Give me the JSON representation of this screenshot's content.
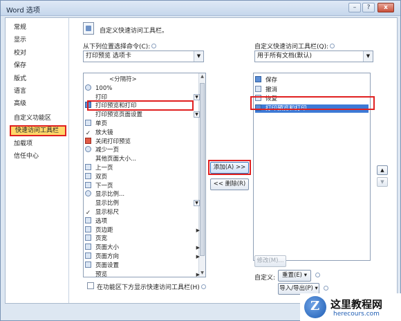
{
  "window": {
    "title": "Word 选项",
    "minimize": "–",
    "maximize": "?",
    "close": "x"
  },
  "nav": {
    "items": [
      "常规",
      "显示",
      "校对",
      "保存",
      "版式",
      "语言",
      "高级",
      "自定义功能区",
      "快速访问工具栏",
      "加载项",
      "信任中心"
    ],
    "active_index": 8
  },
  "main": {
    "heading": "自定义快速访问工具栏。",
    "choose_label": "从下列位置选择命令(C):",
    "choose_value": "打印预览 选项卡",
    "customize_label": "自定义快速访问工具栏(Q):",
    "customize_value": "用于所有文档(默认)",
    "commands": [
      {
        "label": "<分隔符>",
        "icon": "none"
      },
      {
        "label": "100%",
        "icon": "zoom-icon"
      },
      {
        "label": "打印",
        "icon": "none",
        "mark": "dropdown"
      },
      {
        "label": "打印预览和打印",
        "icon": "print-preview-icon"
      },
      {
        "label": "打印预览页面设置",
        "icon": "none",
        "mark": "dropdown"
      },
      {
        "label": "单页",
        "icon": "page-icon"
      },
      {
        "label": "放大镜",
        "icon": "check"
      },
      {
        "label": "关闭打印预览",
        "icon": "close-red-icon"
      },
      {
        "label": "减少一页",
        "icon": "shrink-icon"
      },
      {
        "label": "其他页面大小...",
        "icon": "none"
      },
      {
        "label": "上一页",
        "icon": "prev-page-icon"
      },
      {
        "label": "双页",
        "icon": "two-page-icon"
      },
      {
        "label": "下一页",
        "icon": "next-page-icon"
      },
      {
        "label": "显示比例...",
        "icon": "zoom-icon"
      },
      {
        "label": "显示比例",
        "icon": "none",
        "mark": "dropdown"
      },
      {
        "label": "显示标尺",
        "icon": "check"
      },
      {
        "label": "选项",
        "icon": "options-icon"
      },
      {
        "label": "页边距",
        "icon": "margins-icon",
        "mark": "arrow"
      },
      {
        "label": "页宽",
        "icon": "page-width-icon"
      },
      {
        "label": "页面大小",
        "icon": "page-size-icon",
        "mark": "arrow"
      },
      {
        "label": "页面方向",
        "icon": "orientation-icon",
        "mark": "arrow"
      },
      {
        "label": "页面设置",
        "icon": "page-setup-icon"
      },
      {
        "label": "预览",
        "icon": "none",
        "mark": "arrow"
      }
    ],
    "toolbar_items": [
      {
        "label": "保存",
        "icon": "save-icon"
      },
      {
        "label": "撤消",
        "icon": "undo-icon",
        "mark": "arrow"
      },
      {
        "label": "恢复",
        "icon": "redo-icon"
      },
      {
        "label": "打印预览和打印",
        "icon": "print-preview-icon",
        "selected": true
      }
    ],
    "add_button": "添加(A) >>",
    "remove_button": "<< 删除(R)",
    "modify_button": "修改(M)...",
    "customize_label2": "自定义:",
    "reset_button": "重置(E) ▾",
    "import_export_button": "导入/导出(P) ▾",
    "below_ribbon_checkbox": "在功能区下方显示快速访问工具栏(H)",
    "up_button": "▲",
    "down_button": "▼"
  },
  "watermark": {
    "title": "这里教程网",
    "url": "herecours.com"
  }
}
